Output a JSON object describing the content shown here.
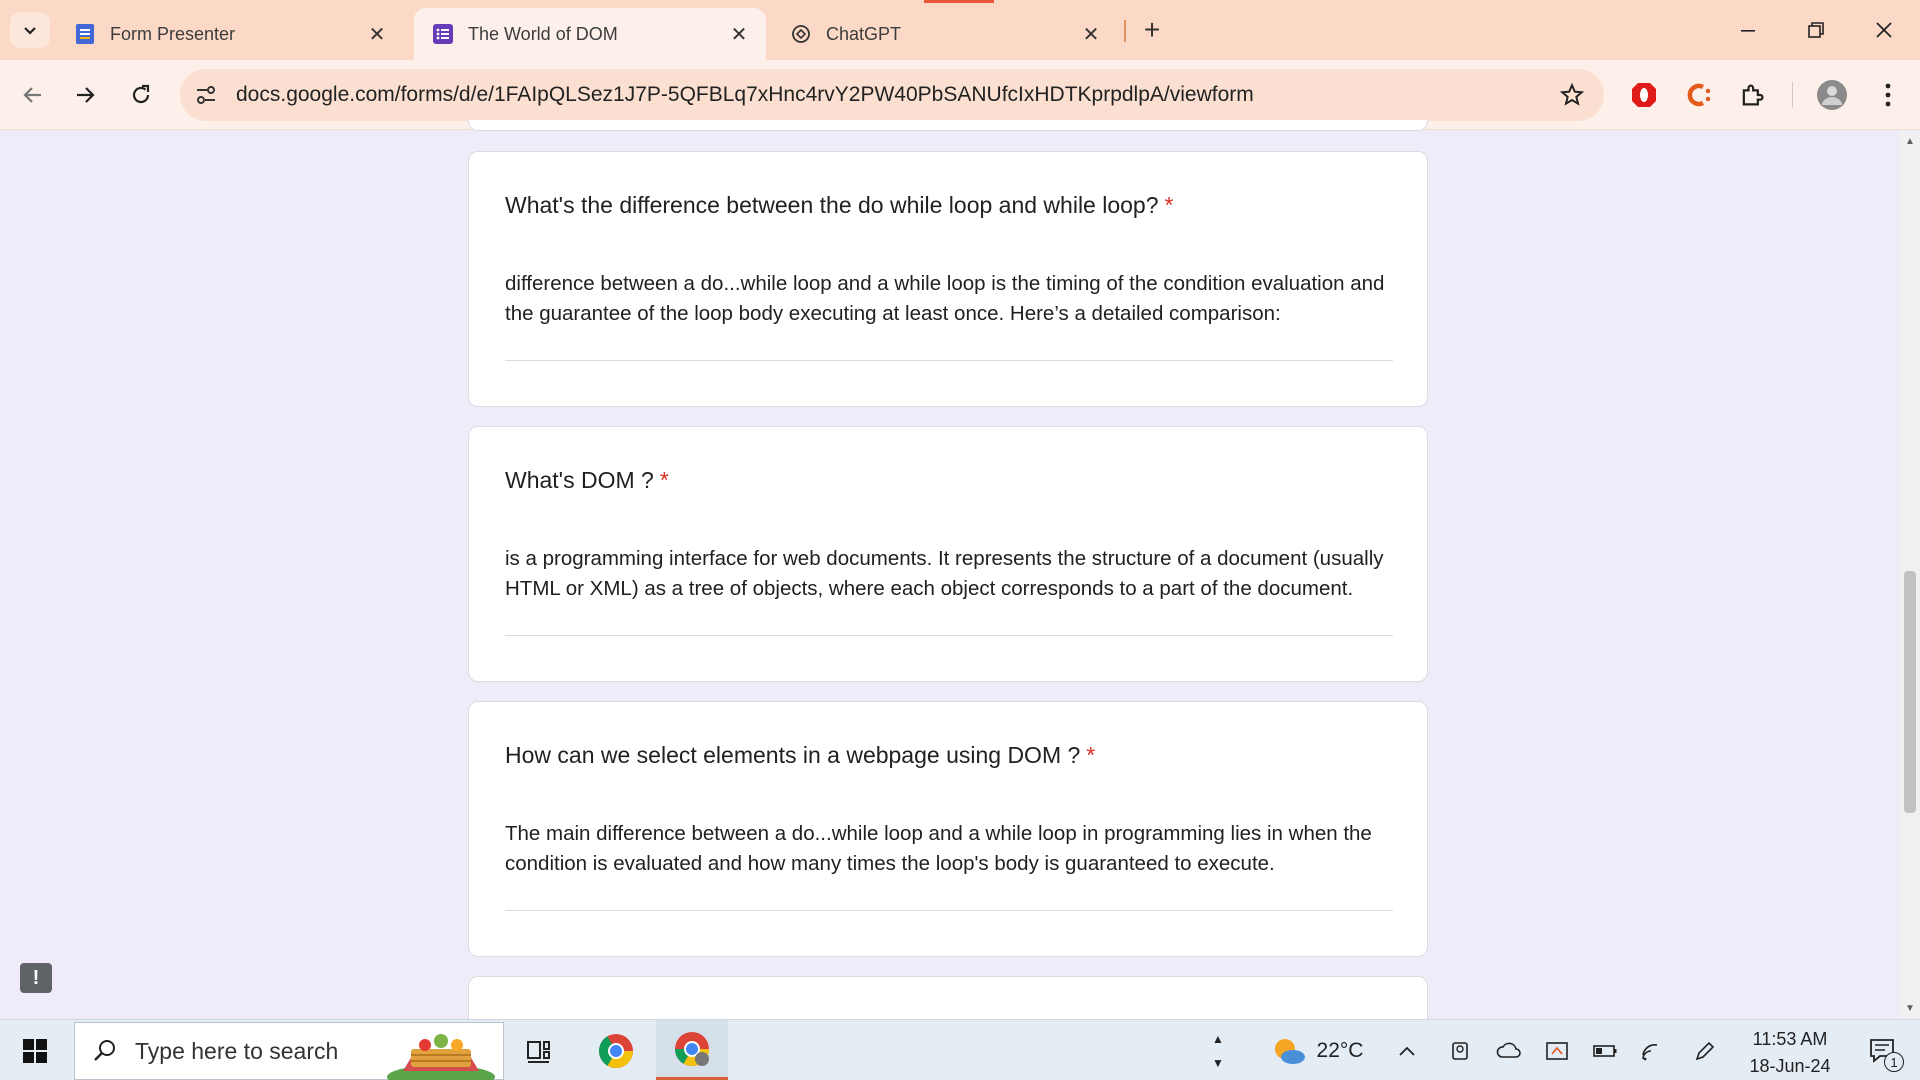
{
  "browser": {
    "tabs": [
      {
        "title": "Form Presenter",
        "icon": "google-forms-icon",
        "active": false
      },
      {
        "title": "The World of DOM",
        "icon": "google-forms-icon",
        "active": true
      },
      {
        "title": "ChatGPT",
        "icon": "chatgpt-icon",
        "active": false
      }
    ],
    "url": "docs.google.com/forms/d/e/1FAIpQLSez1J7P-5QFBLq7xHnc4rvY2PW40PbSANUfcIxHDTKprpdlpA/viewform"
  },
  "form": {
    "questions": [
      {
        "question": "What's the difference between the do while loop and while loop?",
        "required_mark": "*",
        "answer": "difference between a do...while loop and a while loop is the timing of the condition evaluation and the guarantee of the loop body executing at least once. Here’s a detailed comparison:"
      },
      {
        "question": "What's DOM ?",
        "required_mark": "*",
        "answer": "is a programming interface for web documents. It represents the structure of a document (usually HTML or XML) as a tree of objects, where each object corresponds to a part of the document."
      },
      {
        "question": "How can we select elements in a webpage using DOM ?",
        "required_mark": "*",
        "answer": "The main difference between a do...while loop and a while loop in programming lies in when the condition is evaluated and how many times the loop's body is guaranteed to execute."
      }
    ],
    "feedback_icon": "!"
  },
  "taskbar": {
    "search_placeholder": "Type here to search",
    "weather_temp": "22°C",
    "time": "11:53 AM",
    "date": "18-Jun-24",
    "notification_count": "1"
  },
  "colors": {
    "page_bg": "#f0ebf8",
    "required": "#d93025",
    "tabbar_bg": "#fcd9c7",
    "toolbar_bg": "#fdf0ea"
  }
}
